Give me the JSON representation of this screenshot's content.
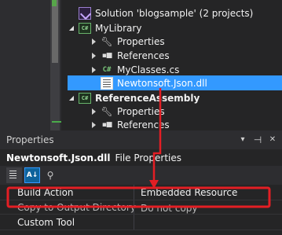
{
  "solution_explorer": {
    "items": [
      {
        "label": "Solution 'blogsample' (2 projects)",
        "icon": "solution-icon",
        "expanded": true,
        "bold": false
      },
      {
        "label": "MyLibrary",
        "icon": "csharp-project-icon",
        "expanded": true,
        "bold": false
      },
      {
        "label": "Properties",
        "icon": "wrench-icon",
        "expanded": false,
        "bold": false
      },
      {
        "label": "References",
        "icon": "references-icon",
        "expanded": false,
        "bold": false
      },
      {
        "label": "MyClasses.cs",
        "icon": "csharp-file-icon",
        "expanded": false,
        "bold": false
      },
      {
        "label": "Newtonsoft.Json.dll",
        "icon": "dll-file-icon",
        "selected": true,
        "bold": false
      },
      {
        "label": "ReferenceAssembly",
        "icon": "csharp-project-icon",
        "expanded": true,
        "bold": true
      },
      {
        "label": "Properties",
        "icon": "wrench-icon",
        "expanded": false,
        "bold": false
      },
      {
        "label": "References",
        "icon": "references-icon",
        "expanded": false,
        "bold": false
      }
    ],
    "selection_color": "#3399ff"
  },
  "properties_panel": {
    "title": "Properties",
    "buttons": {
      "dropdown_glyph": "▾",
      "pin_glyph": "⊣",
      "close_glyph": "✕"
    },
    "object_name": "Newtonsoft.Json.dll",
    "object_type": "File Properties",
    "toolbar": {
      "alphabetical_glyph": "A↓",
      "property_pages_glyph": "⚲"
    },
    "rows": [
      {
        "name": "Build Action",
        "value": "Embedded Resource"
      },
      {
        "name": "Copy to Output Directory",
        "value": "Do not copy"
      },
      {
        "name": "Custom Tool",
        "value": ""
      }
    ]
  },
  "annotation": {
    "color": "#e31e24"
  }
}
